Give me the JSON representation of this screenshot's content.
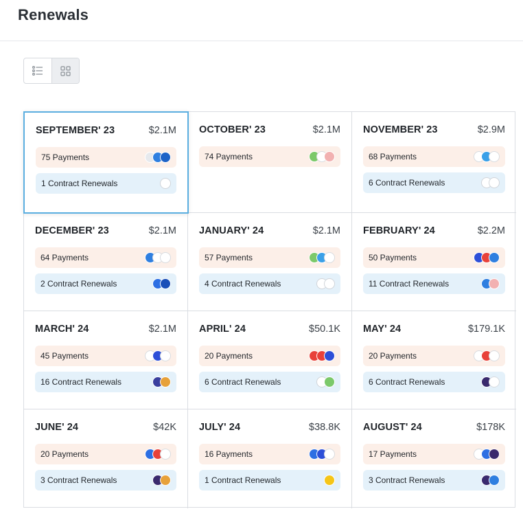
{
  "page": {
    "title": "Renewals"
  },
  "months": [
    {
      "month": "SEPTEMBER' 23",
      "amount": "$2.1M",
      "payments": "75 Payments",
      "renewals": "1 Contract Renewals",
      "selected": true,
      "pay_logos": [
        "#e6e9ed",
        "#2f7fe0",
        "#1e63c7"
      ],
      "ren_logos": [
        "faint"
      ]
    },
    {
      "month": "OCTOBER' 23",
      "amount": "$2.1M",
      "payments": "74 Payments",
      "renewals": "",
      "pay_logos": [
        "#7cc96a",
        "#ffffff",
        "#f2b1b1"
      ],
      "ren_logos": []
    },
    {
      "month": "NOVEMBER' 23",
      "amount": "$2.9M",
      "payments": "68 Payments",
      "renewals": "6 Contract Renewals",
      "pay_logos": [
        "#ffffff",
        "#3aa0e8",
        "#ffffff"
      ],
      "ren_logos": [
        "faint",
        "faint"
      ]
    },
    {
      "month": "DECEMBER' 23",
      "amount": "$2.1M",
      "payments": "64 Payments",
      "renewals": "2 Contract Renewals",
      "pay_logos": [
        "#2f7fe0",
        "#ffffff",
        "#ffffff"
      ],
      "ren_logos": [
        "#2d6fe3",
        "#1b4fb8"
      ]
    },
    {
      "month": "JANUARY' 24",
      "amount": "$2.1M",
      "payments": "57 Payments",
      "renewals": "4 Contract Renewals",
      "pay_logos": [
        "#7cc96a",
        "#3aa0e8",
        "#ffffff"
      ],
      "ren_logos": [
        "faint",
        "faint"
      ]
    },
    {
      "month": "FEBRUARY' 24",
      "amount": "$2.2M",
      "payments": "50 Payments",
      "renewals": "11 Contract Renewals",
      "pay_logos": [
        "#2d4fd8",
        "#e8413a",
        "#2f7fe0"
      ],
      "ren_logos": [
        "#2f7fe0",
        "#f2b1b1"
      ]
    },
    {
      "month": "MARCH' 24",
      "amount": "$2.1M",
      "payments": "45 Payments",
      "renewals": "16 Contract Renewals",
      "pay_logos": [
        "#ffffff",
        "#2d4fd8",
        "#ffffff"
      ],
      "ren_logos": [
        "#3a3f9e",
        "#e7a13a"
      ]
    },
    {
      "month": "APRIL' 24",
      "amount": "$50.1K",
      "payments": "20 Payments",
      "renewals": "6 Contract Renewals",
      "pay_logos": [
        "#e8413a",
        "#e8413a",
        "#2d4fd8"
      ],
      "ren_logos": [
        "faint",
        "#7cc96a"
      ]
    },
    {
      "month": "MAY' 24",
      "amount": "$179.1K",
      "payments": "20 Payments",
      "renewals": "6 Contract Renewals",
      "pay_logos": [
        "#ffffff",
        "#e8413a",
        "#ffffff"
      ],
      "ren_logos": [
        "#3a2a6e",
        "#ffffff"
      ]
    },
    {
      "month": "JUNE' 24",
      "amount": "$42K",
      "payments": "20 Payments",
      "renewals": "3 Contract Renewals",
      "pay_logos": [
        "#2d6fe3",
        "#e8413a",
        "#ffffff"
      ],
      "ren_logos": [
        "#3a2a6e",
        "#e7a13a"
      ]
    },
    {
      "month": "JULY' 24",
      "amount": "$38.8K",
      "payments": "16 Payments",
      "renewals": "1 Contract Renewals",
      "pay_logos": [
        "#2d6fe3",
        "#2d4fd8",
        "#ffffff"
      ],
      "ren_logos": [
        "#f5c518"
      ]
    },
    {
      "month": "AUGUST' 24",
      "amount": "$178K",
      "payments": "17 Payments",
      "renewals": "3 Contract Renewals",
      "pay_logos": [
        "#ffffff",
        "#2d6fe3",
        "#3a2a6e"
      ],
      "ren_logos": [
        "#3a2a6e",
        "#2f7fe0"
      ]
    }
  ],
  "colors": {
    "selected_border": "#5aaee0",
    "payments_bg": "#fcefe8",
    "renewals_bg": "#e4f1fa"
  },
  "icons": {
    "list_view": "list-view-icon",
    "grid_view": "grid-view-icon"
  }
}
